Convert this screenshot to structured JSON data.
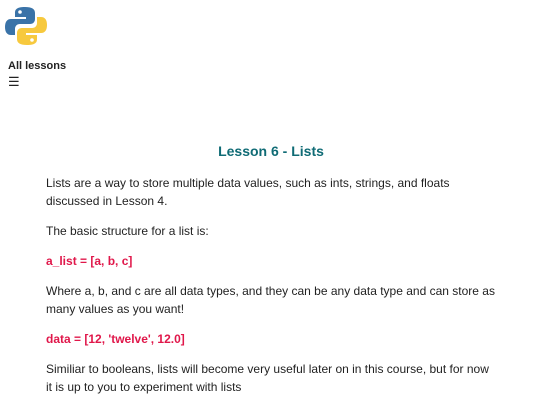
{
  "header": {
    "nav_label": "All lessons",
    "menu_glyph": "☰"
  },
  "lesson": {
    "title": "Lesson 6 - Lists",
    "paragraphs": [
      "Lists are a way to store multiple data values, such as ints, strings, and floats discussed in Lesson 4.",
      "The basic structure for a list is:",
      "a_list = [a, b, c]",
      "Where a, b, and c are all data types, and they can be any data type and can store as many values as you want!",
      "data = [12, 'twelve', 12.0]",
      "Similiar to booleans, lists will become very useful later on in this course, but for now it is up to you to experiment with lists"
    ]
  },
  "colors": {
    "title": "#0f6b75",
    "code": "#e0174a",
    "logo_blue": "#3a73a8",
    "logo_yellow": "#f7c93e"
  }
}
